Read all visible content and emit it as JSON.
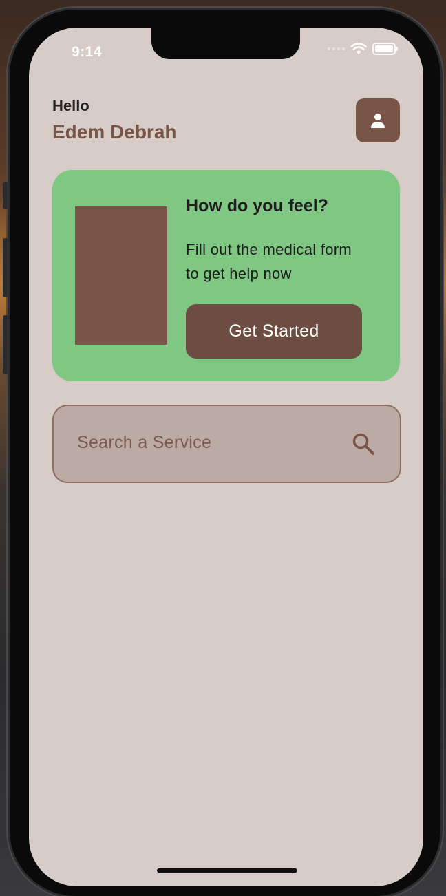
{
  "status_bar": {
    "time": "9:14"
  },
  "header": {
    "greeting": "Hello",
    "username": "Edem Debrah",
    "profile_icon": "person-icon"
  },
  "card": {
    "title": "How do you feel?",
    "body": "Fill out the medical form to get help now",
    "button_label": "Get Started",
    "colors": {
      "card": "#81c784",
      "image": "#795548",
      "button": "#6d4c41"
    }
  },
  "search": {
    "placeholder": "Search a Service",
    "icon": "search-icon"
  },
  "theme": {
    "background": "#d7ccc8",
    "accent": "#795548"
  }
}
